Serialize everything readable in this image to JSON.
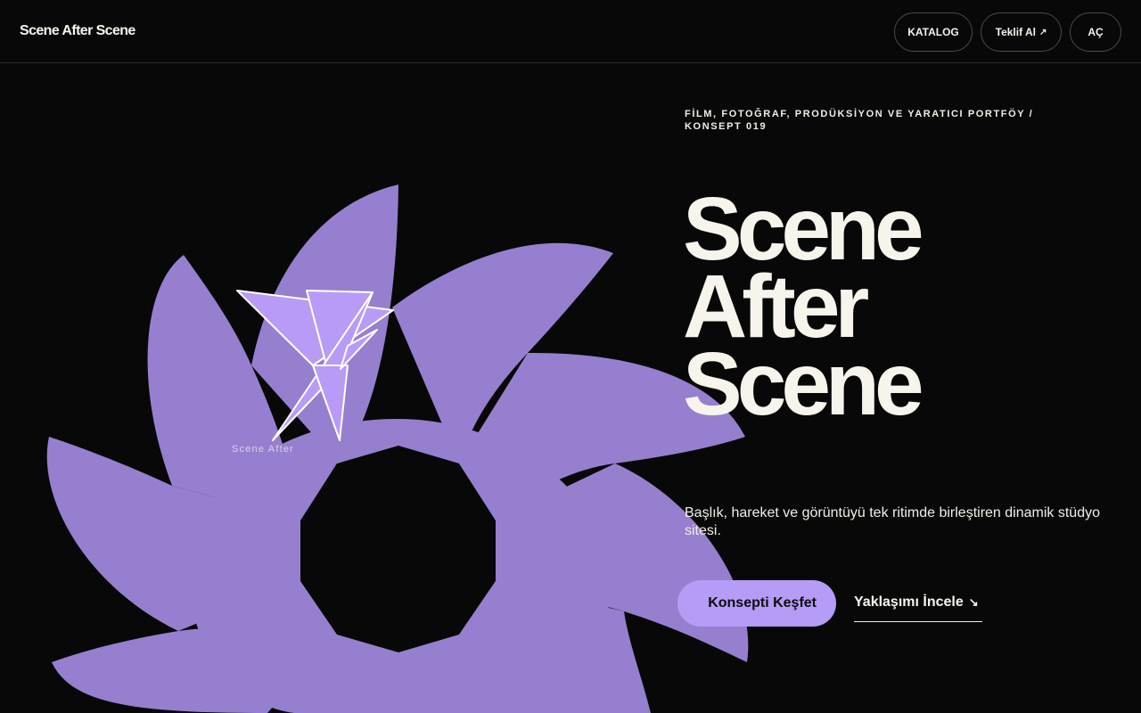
{
  "header": {
    "logo": "Scene After Scene",
    "nav": {
      "catalog": "KATALOG",
      "quote": "Teklif Al",
      "quote_icon": "arrow-up-right-icon",
      "open": "AÇ"
    }
  },
  "hero": {
    "eyebrow": "FİLM, FOTOĞRAF, PRODÜKSİYON VE YARATICI PORTFÖY / KONSEPT 019",
    "title_lines": [
      "Scene",
      "After",
      "Scene"
    ],
    "description": "Başlık, hareket ve görüntüyü tek ritimde birleştiren dinamik stüdyo sitesi.",
    "primary_cta": "Konsepti Keşfet",
    "secondary_cta": "Yaklaşımı İncele",
    "secondary_cta_icon": "arrow-down-right-icon"
  },
  "art": {
    "caption": "Scene After",
    "shape": "purple-pinwheel-flower",
    "overlay": "origami-crane"
  },
  "colors": {
    "background": "#080808",
    "accent": "#b59cf6",
    "shape": "#967fcf",
    "text": "#f4f1ea"
  }
}
